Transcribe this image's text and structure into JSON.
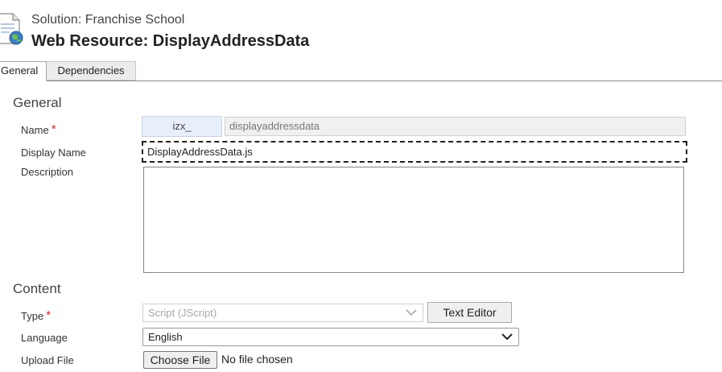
{
  "header": {
    "solution_line": "Solution: Franchise School",
    "title": "Web Resource: DisplayAddressData",
    "icon": "document-globe-icon"
  },
  "tabs": [
    {
      "label": "General",
      "selected": true
    },
    {
      "label": "Dependencies",
      "selected": false
    }
  ],
  "general_section": {
    "title": "General",
    "name_label": "Name",
    "name_required": "*",
    "name_prefix": "izx_",
    "name_value": "displayaddressdata",
    "display_name_label": "Display Name",
    "display_name_value": "DisplayAddressData.js",
    "description_label": "Description",
    "description_value": ""
  },
  "content_section": {
    "title": "Content",
    "type_label": "Type",
    "type_required": "*",
    "type_value": "Script (JScript)",
    "text_editor_label": "Text Editor",
    "language_label": "Language",
    "language_value": "English",
    "upload_label": "Upload File",
    "choose_file_label": "Choose File",
    "file_status": "No file chosen"
  },
  "colors": {
    "required_marker": "#d6262a",
    "prefix_background": "#e8eefa",
    "focus_outline": "#222222"
  }
}
